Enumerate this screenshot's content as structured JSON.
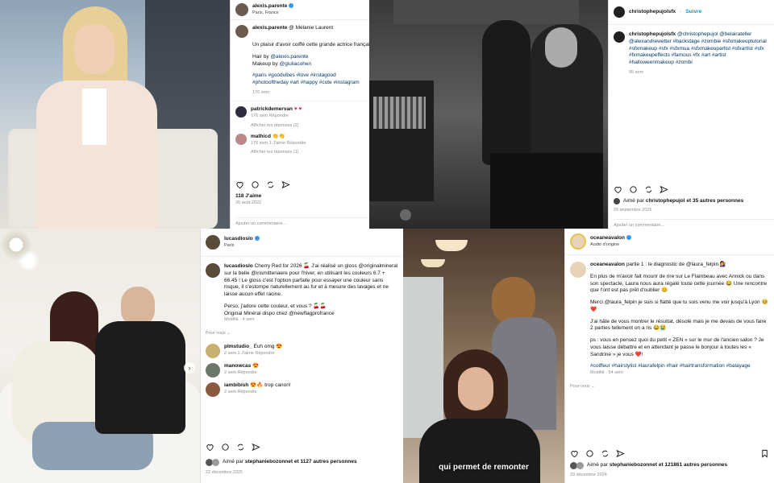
{
  "p1": {
    "user": "alexis.parente",
    "location": "Paris, France",
    "caption_user": "alexis.parente",
    "caption_text": "@ Mélanie Laurent",
    "caption_line2": "Un plaisir d'avoir coiffé cette grande actrice françai",
    "hair": "Hair by",
    "hair_tag": "@alexis.parente",
    "makeup": "Makeup by",
    "makeup_tag": "@giuliacohen",
    "hashtags": "#paris #goodvibes #love #instagood #photooftheday #art #happy #cute #instagram",
    "meta": "176 sem",
    "c1_user": "patrickdemervan",
    "c1_meta": "176 sem   Répondre",
    "c1_replies": "Afficher les réponses (2)",
    "c2_user": "mathicd",
    "c2_meta": "176 sem   1 J'aime   Répondre",
    "c2_replies": "Afficher les réponses (1)",
    "likes": "118 J'aime",
    "date": "26 août 2022",
    "add_comment": "Ajouter un commentaire..."
  },
  "p2": {
    "user": "christophepujolsfx",
    "follow": "Suivre",
    "caption_user": "christophepujolsfx",
    "caption": "@christophepujol @belairateller @alexandrewetter #backstage #zombie #sfxmakeuptutorial #sfxmakeup #sfx #sfxmua #sfxmakeupartist #sfxartist #sfx #fxmakeupeffects #famous #fx #art #artist #halloweenmakeup #zombi",
    "meta": "95 sem",
    "liked_by": "Aimé par",
    "liked_user": "christophepujol",
    "liked_rest": "et 35 autres personnes",
    "date": "29 septembre 2025",
    "add_comment": "Ajouter un commentaire..."
  },
  "p3": {
    "user": "lucasdioslo",
    "location": "Paris",
    "caption_user": "lucasdioslo",
    "caption": "Cherry Red for 2026 🍒 J'ai réalisé un gloss @originalmineral sur la belle @irismittenaere pour l'hiver, en utilisant les couleurs 6.7 + 66.45 ! Le gloss c'est l'option parfaite pour essayer une couleur sans risque, il s'estompe naturellement au fur et à mesure des lavages et ne laisse aucun effet racine.",
    "caption2": "Perso, j'adore cette couleur, et vous ? 🍒🍒",
    "caption3": "Original Minéral dispo chez @newflagprofrance",
    "modified": "Modifié · 4 sem",
    "see_translation": "Pour vous ⌄",
    "c1_user": "plmstudio_",
    "c1_text": "Euh omg 😍",
    "c1_meta": "2 sem   1 J'aime   Répondre",
    "c2_user": "manowcas",
    "c2_text": "😍",
    "c2_meta": "2 sem   Répondre",
    "c3_user": "iambibish",
    "c3_text": "😍🔥 trop canon!",
    "c3_meta": "2 sem   Répondre",
    "liked_by": "Aimé par",
    "liked_user": "stephaniebozonnet",
    "liked_rest": "et 1127 autres personnes",
    "date": "22 décembre 2025"
  },
  "p4": {
    "user": "oceaneavalon",
    "audio": "Audio d'origine",
    "caption_user": "oceaneavalon",
    "caption_p1": "partie 1 : le diagnostic de @laura_felpin 💇‍♀️",
    "caption_p2": "En plus de m'avoir fait mourir de rire sur Le Flambeau avec Annick ou dans son spectacle, Laura nous aura régalé toute cette journée 😂 Une rencontre que l'ont est pas prêt d'oublier 😊",
    "caption_p3": "Merci @laura_felpin je suis si flatté que tu sois venu me voir jusqu'à Lyon 🥹❤️",
    "caption_p4": "J'ai hâte de vous montrer le résultat, désolé mais je me devais de vous faire 2 parties tellement on a ris 😂😭",
    "caption_p5": "ps : vous en pensez quoi du petit « ZEN » sur le mur de l'ancien salon ? Je vous laisse débattre et en attendant je passe le bonjour à toutes les « Sandrine » je vous ❤️!",
    "hashtags": "#coiffeur #hairstylist #laurafelpin #hair #hairtransformation #balayage",
    "modified": "Modifié · 54 sem",
    "see_more": "Pour vous ⌄",
    "liked_by": "Aimé par",
    "liked_user": "stephaniebozonnet",
    "liked_rest": "et 121861 autres personnes",
    "date": "29 décembre 2024",
    "subtitle": "qui permet de remonter"
  }
}
